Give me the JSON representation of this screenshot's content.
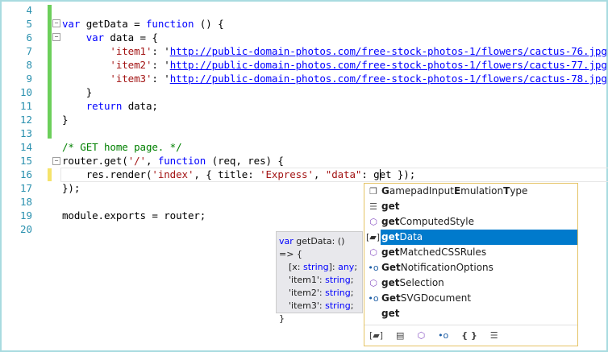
{
  "editor": {
    "lines": [
      {
        "num": "4",
        "tokens": []
      },
      {
        "num": "5",
        "tokens": [
          [
            "var",
            "kw"
          ],
          [
            " getData = ",
            ""
          ],
          [
            "function",
            "kw"
          ],
          [
            " () {",
            ""
          ]
        ]
      },
      {
        "num": "6",
        "tokens": [
          [
            "    ",
            ""
          ],
          [
            "var",
            "kw"
          ],
          [
            " data = {",
            ""
          ]
        ]
      },
      {
        "num": "7",
        "tokens": [
          [
            "        ",
            ""
          ],
          [
            "'item1'",
            "str"
          ],
          [
            ": ",
            ""
          ],
          [
            "'",
            ""
          ],
          [
            "http://public-domain-photos.com/free-stock-photos-1/flowers/cactus-76.jpg",
            "url"
          ],
          [
            "',",
            ""
          ]
        ]
      },
      {
        "num": "8",
        "tokens": [
          [
            "        ",
            ""
          ],
          [
            "'item2'",
            "str"
          ],
          [
            ": ",
            ""
          ],
          [
            "'",
            ""
          ],
          [
            "http://public-domain-photos.com/free-stock-photos-1/flowers/cactus-77.jpg",
            "url"
          ],
          [
            "',",
            ""
          ]
        ]
      },
      {
        "num": "9",
        "tokens": [
          [
            "        ",
            ""
          ],
          [
            "'item3'",
            "str"
          ],
          [
            ": ",
            ""
          ],
          [
            "'",
            ""
          ],
          [
            "http://public-domain-photos.com/free-stock-photos-1/flowers/cactus-78.jpg",
            "url"
          ],
          [
            "'",
            ""
          ]
        ]
      },
      {
        "num": "10",
        "tokens": [
          [
            "    }",
            ""
          ]
        ]
      },
      {
        "num": "11",
        "tokens": [
          [
            "    ",
            ""
          ],
          [
            "return",
            "kw"
          ],
          [
            " data;",
            ""
          ]
        ]
      },
      {
        "num": "12",
        "tokens": [
          [
            "}",
            ""
          ]
        ]
      },
      {
        "num": "13",
        "tokens": []
      },
      {
        "num": "14",
        "tokens": [
          [
            "/* GET home page. */",
            "cm"
          ]
        ]
      },
      {
        "num": "15",
        "tokens": [
          [
            "router.get(",
            ""
          ],
          [
            "'/'",
            "str"
          ],
          [
            ", ",
            ""
          ],
          [
            "function",
            "kw"
          ],
          [
            " (req, res) {",
            ""
          ]
        ]
      },
      {
        "num": "16",
        "tokens": [
          [
            "    res.render(",
            ""
          ],
          [
            "'index'",
            "str"
          ],
          [
            ", { title: ",
            ""
          ],
          [
            "'Express'",
            "str"
          ],
          [
            ", ",
            ""
          ],
          [
            "\"data\"",
            "str"
          ],
          [
            ": get });",
            ""
          ]
        ]
      },
      {
        "num": "17",
        "tokens": [
          [
            "});",
            ""
          ]
        ]
      },
      {
        "num": "18",
        "tokens": []
      },
      {
        "num": "19",
        "tokens": [
          [
            "module.exports = router;",
            ""
          ]
        ]
      },
      {
        "num": "20",
        "tokens": []
      }
    ]
  },
  "completion": {
    "items": [
      {
        "icon": "enum-type-icon",
        "glyph": "❐",
        "bold": "G",
        "rest": "amepadInput",
        "bold2": "E",
        "rest2": "mulation",
        "bold3": "T",
        "rest3": "ype"
      },
      {
        "icon": "keyword-icon",
        "glyph": "☰",
        "bold": "get",
        "rest": ""
      },
      {
        "icon": "method-icon",
        "glyph": "⬡",
        "bold": "get",
        "rest": "ComputedStyle"
      },
      {
        "icon": "variable-icon",
        "glyph": "[▰]",
        "bold": "get",
        "rest": "Data",
        "selected": true
      },
      {
        "icon": "method-icon",
        "glyph": "⬡",
        "bold": "get",
        "rest": "MatchedCSSRules"
      },
      {
        "icon": "interface-icon",
        "glyph": "•o",
        "bold": "Get",
        "rest": "NotificationOptions"
      },
      {
        "icon": "method-icon",
        "glyph": "⬡",
        "bold": "get",
        "rest": "Selection"
      },
      {
        "icon": "interface-icon",
        "glyph": "•o",
        "bold": "Get",
        "rest": "SVGDocument"
      },
      {
        "icon": "none",
        "glyph": "",
        "bold": "get",
        "rest": ""
      }
    ],
    "filters": [
      {
        "name": "variables-filter-icon",
        "glyph": "[▰]"
      },
      {
        "name": "properties-filter-icon",
        "glyph": "▤"
      },
      {
        "name": "methods-filter-icon",
        "glyph": "⬡"
      },
      {
        "name": "interfaces-filter-icon",
        "glyph": "•o"
      },
      {
        "name": "modules-filter-icon",
        "glyph": "{ }"
      },
      {
        "name": "keywords-filter-icon",
        "glyph": "☰"
      }
    ]
  },
  "tooltip": {
    "l1_kw": "var",
    "l1": " getData: () => {",
    "l2a": "[x: ",
    "l2b": "string",
    "l2c": "]: ",
    "l2d": "any",
    "l2e": ";",
    "l3a": "'item1': ",
    "l3b": "string",
    "l3c": ";",
    "l4a": "'item2': ",
    "l4b": "string",
    "l4c": ";",
    "l5a": "'item3': ",
    "l5b": "string",
    "l5c": ";",
    "l6": "}"
  },
  "colors": {
    "keyword": "#0000ff",
    "string": "#a31515",
    "comment": "#008000",
    "selection": "#007acc"
  }
}
